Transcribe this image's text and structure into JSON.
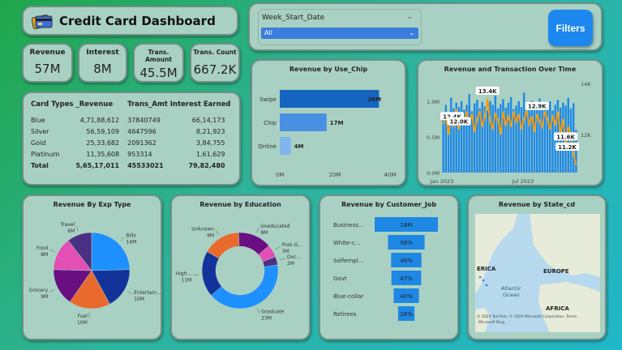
{
  "header": {
    "title": "Credit Card Dashboard",
    "logo_icon": "credit-card-icon"
  },
  "kpis": [
    {
      "label": "Revenue",
      "value": "57M"
    },
    {
      "label": "Interest",
      "value": "8M"
    },
    {
      "label": "Trans.\nAmount",
      "value": "45.5M"
    },
    {
      "label": "Trans. Count",
      "value": "667.2K"
    }
  ],
  "table": {
    "headers": [
      "Card Types",
      "_Revenue",
      "Trans_Amt",
      "Interest Earned"
    ],
    "rows": [
      [
        "Blue",
        "4,71,88,612",
        "37840749",
        "66,14,173"
      ],
      [
        "Silver",
        "56,59,109",
        "4647596",
        "8,21,923"
      ],
      [
        "Gold",
        "25,33,682",
        "2091362",
        "3,84,755"
      ],
      [
        "Platinum",
        "11,35,608",
        "953314",
        "1,61,629"
      ]
    ],
    "total": [
      "Total",
      "5,65,17,011",
      "45533021",
      "79,82,480"
    ]
  },
  "filter": {
    "label": "Week_Start_Date",
    "selected": "All",
    "button_label": "Filters"
  },
  "chart_data": [
    {
      "type": "bar",
      "title": "Revenue by Use_Chip",
      "orientation": "horizontal",
      "categories": [
        "Swipe",
        "Chip",
        "Online"
      ],
      "values": [
        36,
        17,
        4
      ],
      "data_labels": [
        "36M",
        "17M",
        "4M"
      ],
      "xticks": [
        "0M",
        "20M",
        "40M"
      ],
      "xlim": [
        0,
        40
      ],
      "colors": [
        "#1565c0",
        "#4a90e2",
        "#7fb6f0"
      ]
    },
    {
      "type": "bar+line",
      "title": "Revenue and Transaction Over Time",
      "y_left_ticks": [
        "1.0M",
        "0.5M",
        "0.0M"
      ],
      "y_right_ticks": [
        "14K",
        "12K"
      ],
      "x_ticks": [
        "Jan 2023",
        "Jul 2023"
      ],
      "bar_color": "#1e88e5",
      "line_color": "#f39c12",
      "bar_values": [
        0.85,
        0.95,
        0.8,
        1.05,
        0.9,
        0.98,
        0.92,
        1.0,
        0.88,
        0.95,
        1.1,
        0.86,
        0.97,
        1.02,
        0.9,
        0.99,
        0.93,
        0.87,
        1.0,
        0.95,
        1.08,
        0.9,
        0.96,
        1.03,
        0.91,
        0.98,
        1.06,
        0.89,
        0.94,
        1.0,
        0.92,
        1.12,
        0.9,
        0.97,
        1.01,
        0.88,
        0.96,
        1.04,
        0.9,
        0.99,
        0.93,
        1.0,
        0.87,
        0.95,
        1.02,
        0.91,
        0.98,
        0.94,
        1.05,
        0.9,
        0.97,
        0.6
      ],
      "line_values": [
        12.4,
        12.8,
        12.0,
        12.6,
        12.3,
        13.0,
        12.2,
        12.7,
        12.5,
        12.9,
        12.4,
        12.8,
        12.1,
        12.6,
        12.9,
        12.3,
        12.7,
        13.4,
        12.5,
        12.2,
        12.8,
        12.6,
        12.0,
        12.9,
        12.4,
        12.7,
        12.3,
        12.9,
        12.5,
        12.8,
        12.2,
        12.6,
        12.9,
        12.4,
        12.7,
        12.1,
        12.8,
        12.5,
        12.3,
        12.9,
        12.6,
        12.2,
        12.7,
        12.4,
        12.9,
        12.0,
        12.6,
        11.6,
        12.3,
        12.0,
        11.2,
        10.8
      ],
      "ylim_left": [
        0,
        1.25
      ],
      "ylim_right": [
        10.5,
        14
      ],
      "data_labels": [
        {
          "text": "13.4K",
          "index": 17
        },
        {
          "text": "12.4K",
          "index": 0
        },
        {
          "text": "12.0K",
          "index": 6
        },
        {
          "text": "12.9K",
          "index": 36
        },
        {
          "text": "11.6K",
          "index": 47
        },
        {
          "text": "11.2K",
          "index": 50
        }
      ]
    },
    {
      "type": "pie",
      "title": "Revenue By Exp Type",
      "slices": [
        {
          "label": "Bills",
          "value": 14,
          "display": "Bills 14M",
          "color": "#1e90ff"
        },
        {
          "label": "Entertain...",
          "value": 10,
          "display": "Entertain... 10M",
          "color": "#13339b"
        },
        {
          "label": "Fuel",
          "value": 10,
          "display": "Fuel 10M",
          "color": "#ea6a2d"
        },
        {
          "label": "Grocery",
          "value": 9,
          "display": "Grocery 9M",
          "color": "#6a0f82"
        },
        {
          "label": "Food",
          "value": 8,
          "display": "Food 8M",
          "color": "#e34fb4"
        },
        {
          "label": "Travel",
          "value": 6,
          "display": "Travel 6M",
          "color": "#4a3184"
        }
      ]
    },
    {
      "type": "donut",
      "title": "Revenue by Education",
      "slices": [
        {
          "label": "Unknown",
          "value": 9,
          "display": "Unknown 9M",
          "color": "#ea6a2d"
        },
        {
          "label": "Uneducated",
          "value": 8,
          "display": "Uneducated 8M",
          "color": "#6a0f82"
        },
        {
          "label": "Post-G...",
          "value": 3,
          "display": "Post-G... 3M",
          "color": "#e34fb4"
        },
        {
          "label": "Doc...",
          "value": 2,
          "display": "Doc... 2M",
          "color": "#4a3184"
        },
        {
          "label": "Graduate",
          "value": 23,
          "display": "Graduate 23M",
          "color": "#1e90ff"
        },
        {
          "label": "High...",
          "value": 11,
          "display": "High... 11M",
          "color": "#13339b"
        }
      ]
    },
    {
      "type": "bar",
      "title": "Revenue by Customer_Job",
      "orientation": "funnel",
      "categories": [
        "Business...",
        "White-c...",
        "Selfempl...",
        "Govt",
        "Blue-collar",
        "Retirees"
      ],
      "values": [
        100,
        58,
        48,
        47,
        40,
        26
      ],
      "data_labels": [
        "18M",
        "58%",
        "48%",
        "47%",
        "40%",
        "26%"
      ],
      "color": "#1e88e5"
    }
  ],
  "map": {
    "title": "Revenue by State_cd",
    "labels": [
      "ERICA",
      "EUROPE",
      "Atlantic\nOcean",
      "AFRICA"
    ],
    "attribution": "© 2024 TomTom, © 2024 Microsoft Corporation, Terms",
    "brand": "Microsoft Bing"
  }
}
